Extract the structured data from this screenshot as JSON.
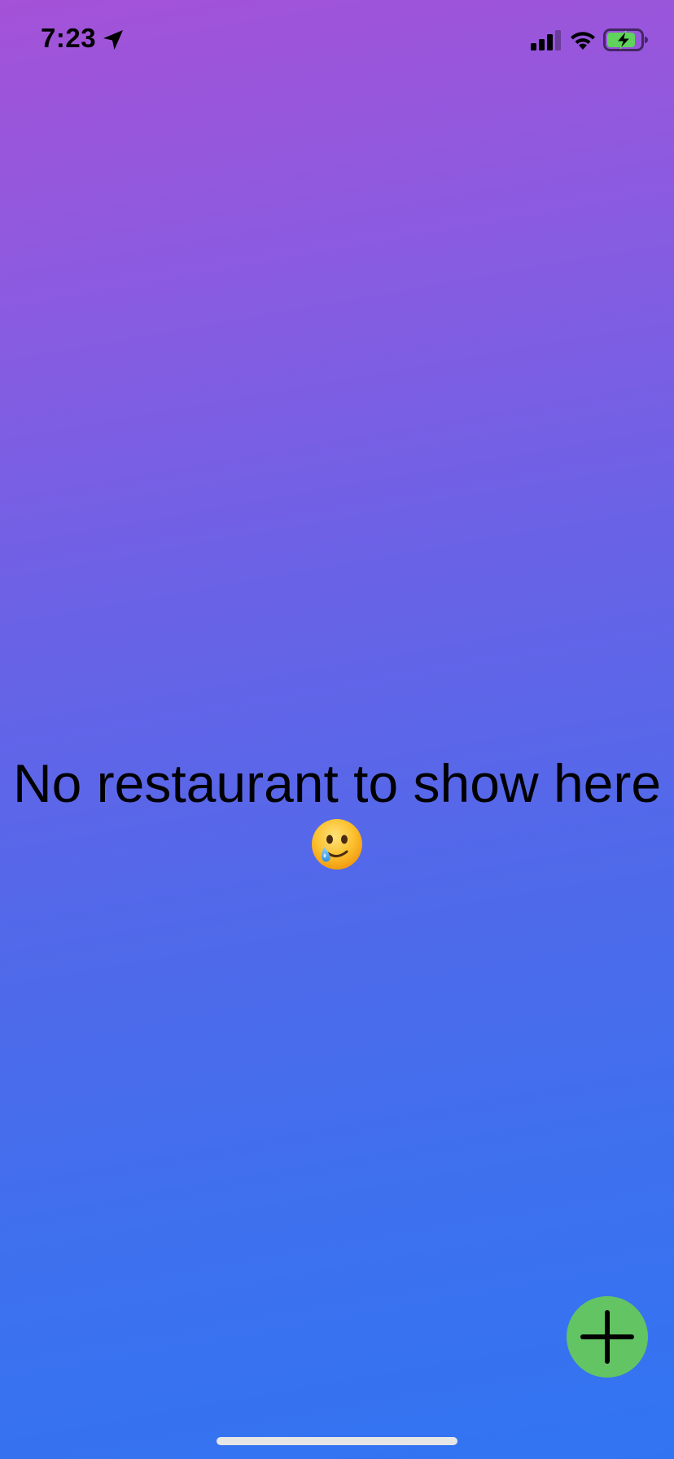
{
  "status_bar": {
    "time": "7:23",
    "location_icon": "location-arrow-icon",
    "signal_icon": "cellular-signal-icon",
    "wifi_icon": "wifi-icon",
    "battery_icon": "battery-charging-icon"
  },
  "empty_state": {
    "message": "No restaurant to show here",
    "emoji_icon": "face-holding-back-tears-icon"
  },
  "fab": {
    "icon": "plus-icon",
    "color": "#62c463"
  },
  "colors": {
    "gradient_top": "#a452d8",
    "gradient_bottom": "#3174f2"
  }
}
